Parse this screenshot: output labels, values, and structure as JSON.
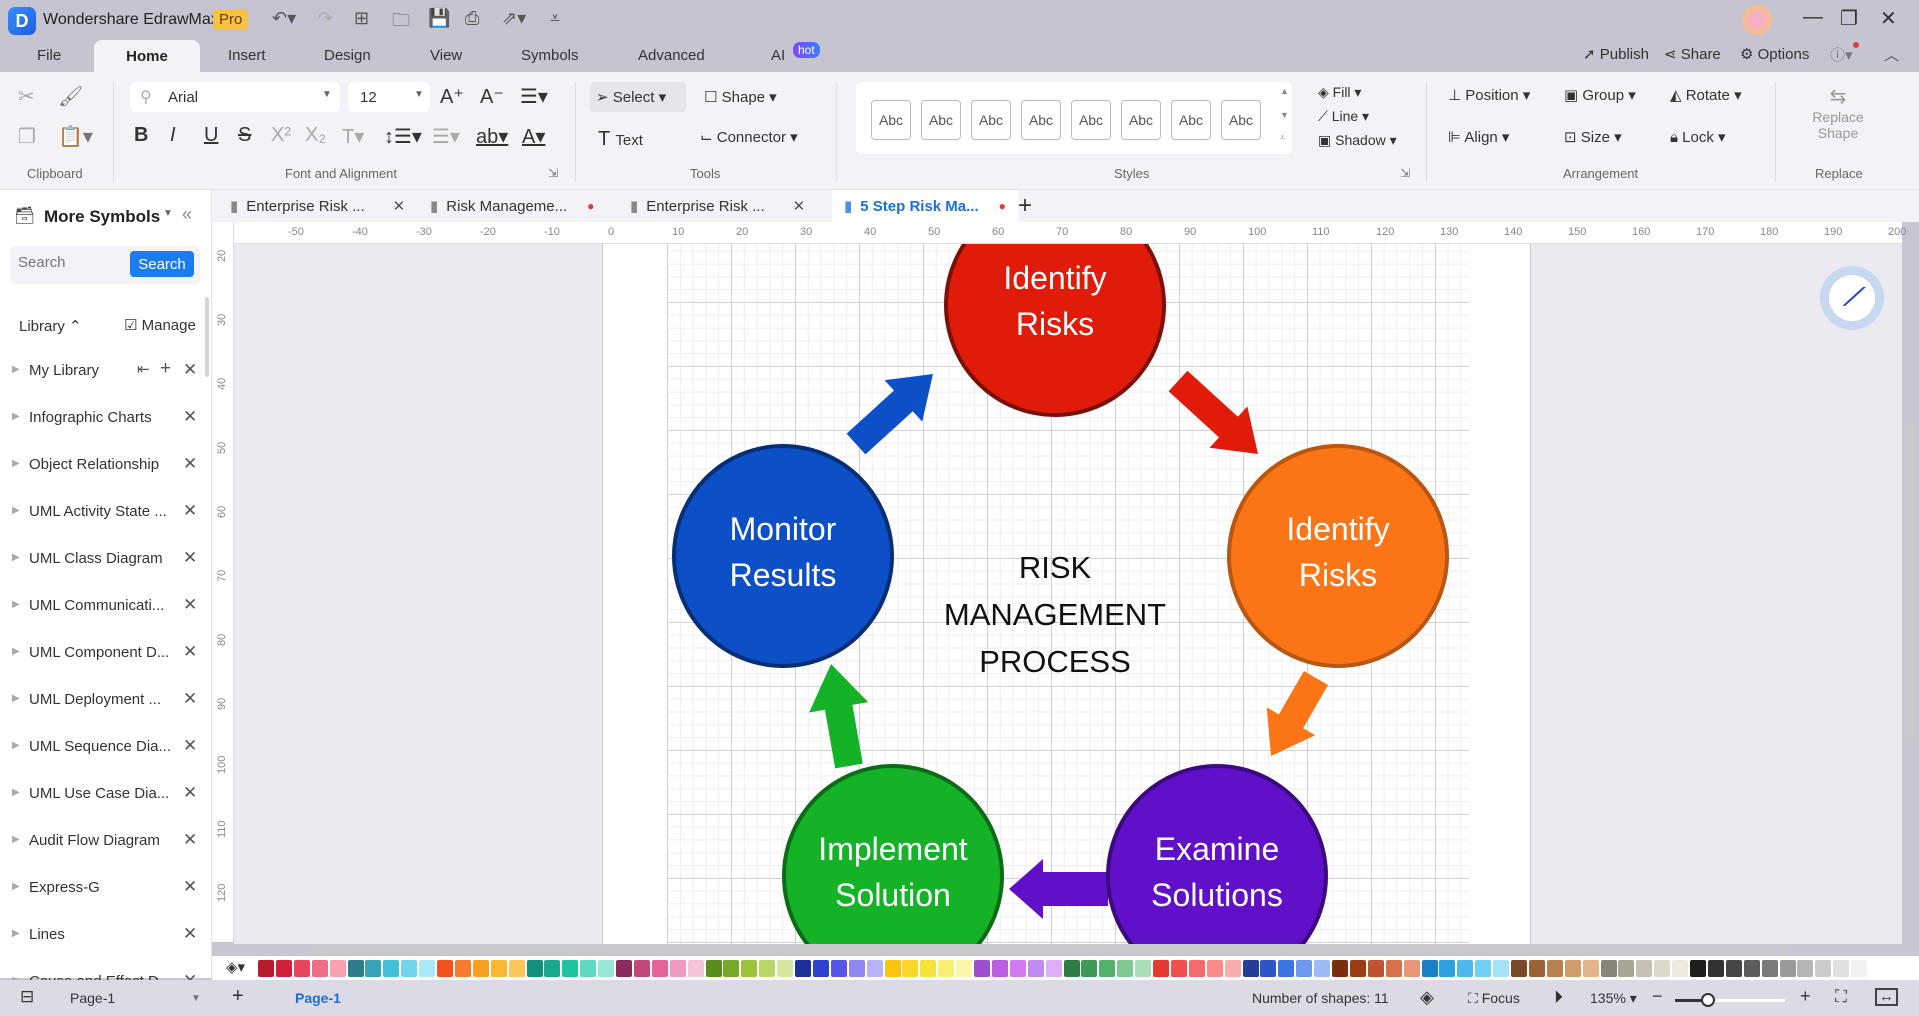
{
  "app": {
    "title": "Wondershare EdrawMax",
    "badge": "Pro",
    "quick_access": [
      "undo-icon",
      "redo-icon",
      "new-icon",
      "open-icon",
      "save-icon",
      "print-icon",
      "export-icon",
      "customize-icon"
    ]
  },
  "menu": {
    "items": [
      "File",
      "Home",
      "Insert",
      "Design",
      "View",
      "Symbols",
      "Advanced",
      "AI"
    ],
    "active": "Home",
    "ai_badge": "hot",
    "right": {
      "publish": "Publish",
      "share": "Share",
      "options": "Options"
    }
  },
  "ribbon": {
    "groups": {
      "clipboard": "Clipboard",
      "font": "Font and Alignment",
      "tools": "Tools",
      "styles": "Styles",
      "arrangement": "Arrangement",
      "replace": "Replace"
    },
    "font_family": "Arial",
    "font_size": "12",
    "tools": {
      "select": "Select",
      "shape": "Shape",
      "text": "Text",
      "connector": "Connector"
    },
    "style_swatches": [
      "Abc",
      "Abc",
      "Abc",
      "Abc",
      "Abc",
      "Abc",
      "Abc",
      "Abc"
    ],
    "style_props": {
      "fill": "Fill",
      "line": "Line",
      "shadow": "Shadow"
    },
    "arrangement": {
      "position": "Position",
      "group": "Group",
      "rotate": "Rotate",
      "align": "Align",
      "size": "Size",
      "lock": "Lock"
    },
    "replace_shape": "Replace Shape"
  },
  "sidebar": {
    "title": "More Symbols",
    "search_placeholder": "Search",
    "search_button": "Search",
    "library_label": "Library",
    "manage_label": "Manage",
    "libraries": [
      "My Library",
      "Infographic Charts",
      "Object Relationship",
      "UML Activity State ...",
      "UML Class Diagram",
      "UML Communicati...",
      "UML Component D...",
      "UML Deployment ...",
      "UML Sequence Dia...",
      "UML Use Case Dia...",
      "Audit Flow Diagram",
      "Express-G",
      "Lines",
      "Cause and Effect D..."
    ]
  },
  "tabs": [
    {
      "label": "Enterprise Risk ...",
      "state": "close",
      "active": false
    },
    {
      "label": "Risk Manageme...",
      "state": "unsaved",
      "active": false
    },
    {
      "label": "Enterprise Risk ...",
      "state": "close",
      "active": false
    },
    {
      "label": "5 Step Risk Ma...",
      "state": "unsaved",
      "active": true
    }
  ],
  "rulers": {
    "horizontal": [
      "-50",
      "-40",
      "-30",
      "-20",
      "-10",
      "0",
      "10",
      "20",
      "30",
      "40",
      "50",
      "60",
      "70",
      "80",
      "90",
      "100",
      "110",
      "120",
      "130",
      "140",
      "150",
      "160",
      "170",
      "180",
      "190",
      "200"
    ],
    "vertical": [
      "20",
      "30",
      "40",
      "50",
      "60",
      "70",
      "80",
      "90",
      "100",
      "110",
      "120"
    ]
  },
  "diagram": {
    "center_title": [
      "RISK",
      "MANAGEMENT",
      "PROCESS"
    ],
    "steps": [
      {
        "lines": [
          "Identify",
          "Risks"
        ],
        "fill": "#e01b0a",
        "stroke": "#7a1108"
      },
      {
        "lines": [
          "Identify",
          "Risks"
        ],
        "fill": "#fb7516",
        "stroke": "#b9560f"
      },
      {
        "lines": [
          "Examine",
          "Solutions"
        ],
        "fill": "#6110c9",
        "stroke": "#3c0a7e"
      },
      {
        "lines": [
          "Implement",
          "Solution"
        ],
        "fill": "#14b327",
        "stroke": "#0b6b17"
      },
      {
        "lines": [
          "Monitor",
          "Results"
        ],
        "fill": "#0c4fc7",
        "stroke": "#072e74"
      }
    ],
    "arrow_colors": {
      "red": "#e01b0a",
      "orange": "#fb7516",
      "purple": "#6110c9",
      "green": "#14b327",
      "blue": "#0c4fc7"
    }
  },
  "palette": [
    "#b71c2c",
    "#d1213a",
    "#e84561",
    "#f06d88",
    "#f6a1b2",
    "#2e7d8c",
    "#36a3b8",
    "#42bfd9",
    "#6fd4ec",
    "#a8e8f7",
    "#f4511e",
    "#f57c2f",
    "#f9a01f",
    "#fbb534",
    "#fcc65a",
    "#13907b",
    "#18a88e",
    "#1fc3a4",
    "#5ed8be",
    "#98e8d6",
    "#8b2a5e",
    "#c2477d",
    "#e4649a",
    "#f09ac0",
    "#f6c5da",
    "#5a8d1f",
    "#78a82a",
    "#9cc43a",
    "#bad768",
    "#d6e7a1",
    "#1e2fa0",
    "#3043d0",
    "#5955e8",
    "#8e88f0",
    "#b7b1f6",
    "#f8c40f",
    "#fbd72b",
    "#f7e43a",
    "#f9ef73",
    "#fbf6a8",
    "#9e4fd0",
    "#bb5fe0",
    "#d27af0",
    "#c08af0",
    "#dcb0f6",
    "#2f7d45",
    "#3e9a57",
    "#52b26b",
    "#7fca92",
    "#a9dfb6",
    "#e53935",
    "#ef4f4f",
    "#f46a6a",
    "#f98a8a",
    "#fbadad",
    "#243f96",
    "#2e57c6",
    "#3d73e2",
    "#6d98ee",
    "#9dbaf4",
    "#7a2e0f",
    "#9b3d12",
    "#bf5230",
    "#d6714b",
    "#e6967a",
    "#1a82c4",
    "#2fa0e0",
    "#4cb8ee",
    "#6fd0f4",
    "#a3e2f8",
    "#7a4a2a",
    "#9b6238",
    "#b9814f",
    "#d09b6c",
    "#e6b48a",
    "#8a8478",
    "#a9a496",
    "#c5c0b2",
    "#ddd8ca",
    "#eeeadf",
    "#1e1e1e",
    "#333333",
    "#474747",
    "#5c5c5c",
    "#7a7a7a",
    "#9a9a9a",
    "#b5b5b5",
    "#cccccc",
    "#e0e0e0",
    "#f2f2f2"
  ],
  "status": {
    "page_selector": "Page-1",
    "active_page": "Page-1",
    "shape_count": "Number of shapes: 11",
    "focus": "Focus",
    "zoom": "135%",
    "zoom_fraction": 0.3
  }
}
